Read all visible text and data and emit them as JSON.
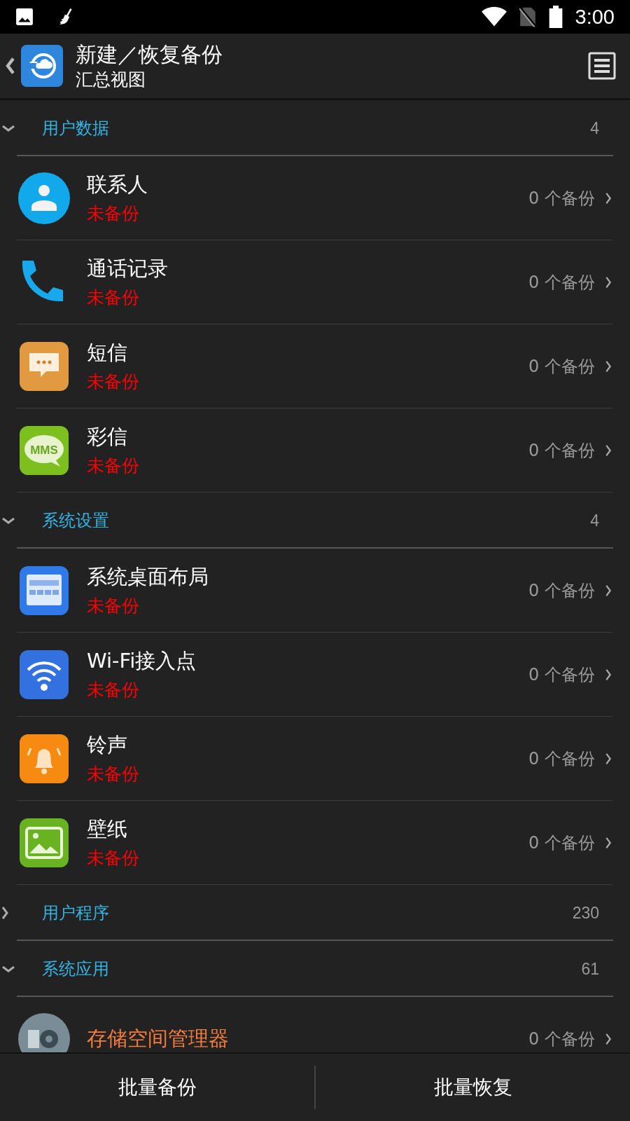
{
  "status_bar": {
    "time": "3:00"
  },
  "header": {
    "title": "新建／恢复备份",
    "subtitle": "汇总视图"
  },
  "sections": [
    {
      "label": "用户数据",
      "count": "4",
      "expanded": true,
      "items": [
        {
          "kind": "contacts",
          "title": "联系人",
          "highlighted": false,
          "status": "未备份",
          "backups": "0 个备份"
        },
        {
          "kind": "phone",
          "title": "通话记录",
          "highlighted": false,
          "status": "未备份",
          "backups": "0 个备份"
        },
        {
          "kind": "sms",
          "title": "短信",
          "highlighted": false,
          "status": "未备份",
          "backups": "0 个备份"
        },
        {
          "kind": "mms",
          "title": "彩信",
          "icon_text": "MMS",
          "highlighted": false,
          "status": "未备份",
          "backups": "0 个备份"
        }
      ]
    },
    {
      "label": "系统设置",
      "count": "4",
      "expanded": true,
      "items": [
        {
          "kind": "desktop",
          "title": "系统桌面布局",
          "highlighted": false,
          "status": "未备份",
          "backups": "0 个备份"
        },
        {
          "kind": "wifi",
          "title": "Wi-Fi接入点",
          "highlighted": false,
          "status": "未备份",
          "backups": "0 个备份"
        },
        {
          "kind": "ringtone",
          "title": "铃声",
          "highlighted": false,
          "status": "未备份",
          "backups": "0 个备份"
        },
        {
          "kind": "wallpaper",
          "title": "壁纸",
          "highlighted": false,
          "status": "未备份",
          "backups": "0 个备份"
        }
      ]
    },
    {
      "label": "用户程序",
      "count": "230",
      "expanded": false
    },
    {
      "label": "系统应用",
      "count": "61",
      "expanded": true,
      "items": [
        {
          "kind": "storage",
          "title": "存储空间管理器",
          "highlighted": true,
          "backups": "0 个备份"
        }
      ]
    }
  ],
  "buttons": [
    "批量备份",
    "批量恢复"
  ]
}
